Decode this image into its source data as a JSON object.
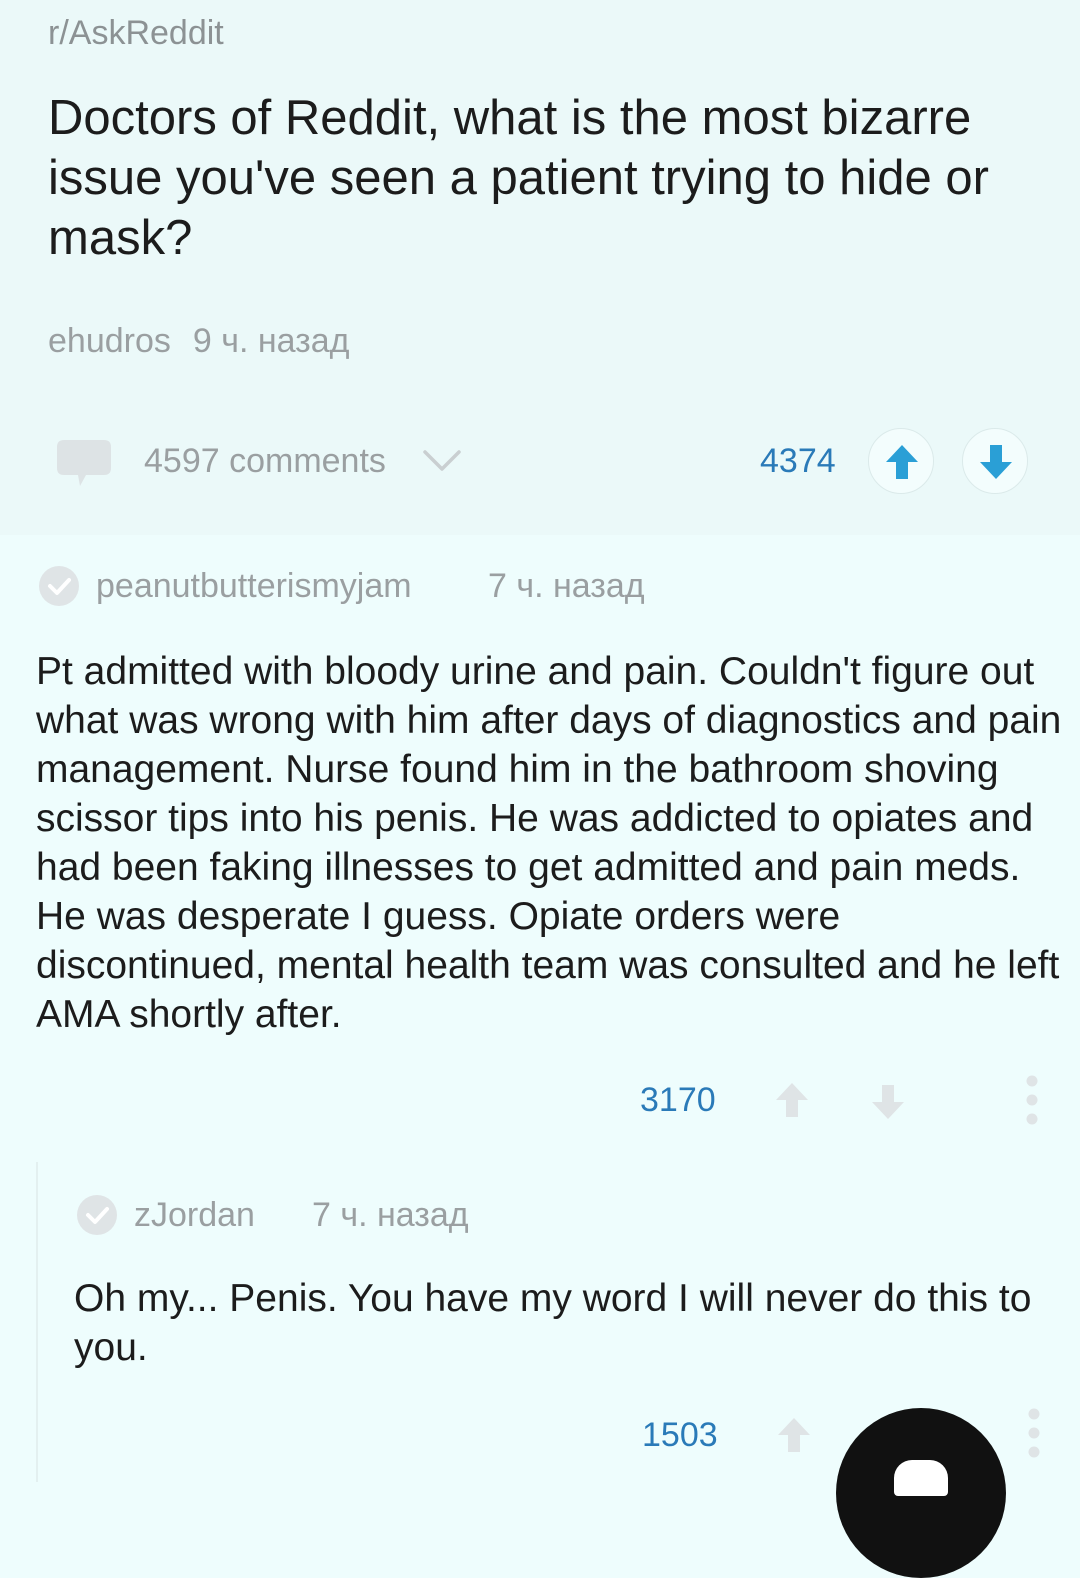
{
  "post": {
    "subreddit": "r/AskReddit",
    "title": "Doctors of Reddit, what is the most bizarre issue you've seen a patient trying to hide or mask?",
    "author": "ehudros",
    "time": "9 ч. назад",
    "comments": "4597 comments",
    "score": "4374"
  },
  "comments": [
    {
      "author": "peanutbutterismyjam",
      "time": "7 ч. назад",
      "body": "Pt admitted with bloody urine and pain. Couldn't figure out what was wrong with him after days of diagnostics and pain management. Nurse found him in the bathroom shoving scissor tips into his penis. He was addicted to opiates and had been faking illnesses to get admitted and pain meds. He was desperate I guess. Opiate orders were discontinued, mental health team was consulted and he left AMA shortly after.",
      "score": "3170"
    },
    {
      "author": "zJordan",
      "time": "7 ч. назад",
      "body": "Oh my... Penis. You have my word I will never do this to you.",
      "score": "1503"
    }
  ],
  "colors": {
    "accent": "#2a9fd6",
    "score": "#2a7ab8",
    "muted": "#9a9fa1",
    "background": "#eefdfd"
  },
  "icons": {
    "comments": "speech-bubble-icon",
    "expand": "chevron-down-icon",
    "upvote": "arrow-up-icon",
    "downvote": "arrow-down-icon",
    "more": "more-vertical-icon",
    "verified": "checkmark-circle-icon"
  }
}
